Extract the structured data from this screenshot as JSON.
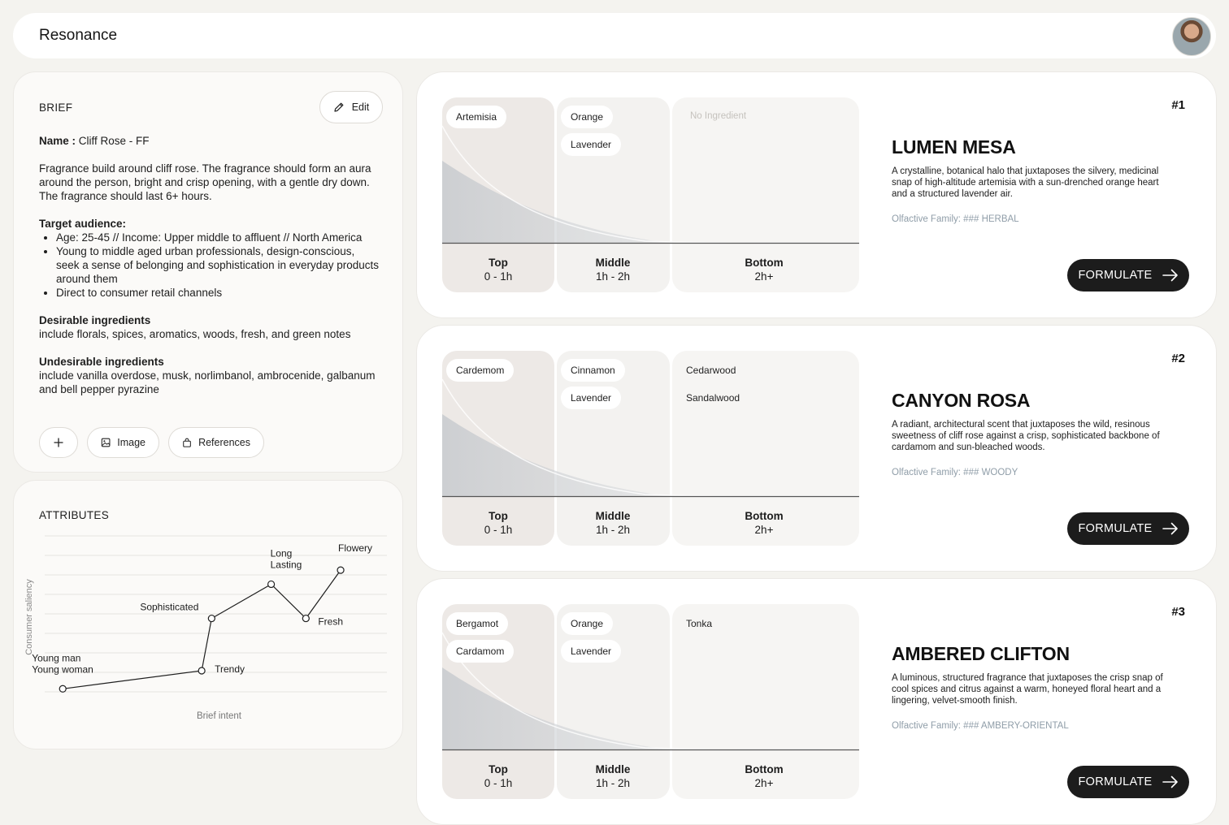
{
  "app": {
    "title": "Resonance"
  },
  "brief": {
    "title": "BRIEF",
    "edit_label": "Edit",
    "name_label": "Name :",
    "name_value": "Cliff Rose - FF",
    "description": "Fragrance build around cliff rose. The fragrance should form an aura around the person, bright and crisp opening, with a gentle dry down. The fragrance should last 6+ hours.",
    "target_heading": "Target audience:",
    "target_items": [
      "Age: 25-45 // Income: Upper middle to affluent // North America",
      "Young to middle aged urban professionals, design-conscious, seek a sense of belonging and sophistication in everyday products around them",
      "Direct to consumer retail channels"
    ],
    "desirable_heading": "Desirable ingredients",
    "desirable_text": "include florals, spices, aromatics, woods, fresh, and green notes",
    "undesirable_heading": "Undesirable ingredients",
    "undesirable_text": "include vanilla overdose, musk, norlimbanol, ambrocenide, galbanum and bell pepper pyrazine",
    "image_label": "Image",
    "references_label": "References"
  },
  "attributes": {
    "title": "ATTRIBUTES"
  },
  "chart_data": {
    "type": "line",
    "xlabel": "Brief intent",
    "ylabel": "Consumer saliency",
    "points": [
      {
        "label": "Young man\nYoung woman",
        "x": 0,
        "y": 0
      },
      {
        "label": "Trendy",
        "x": 2.8,
        "y": 0.9
      },
      {
        "label": "Sophisticated",
        "x": 3.0,
        "y": 3.5
      },
      {
        "label": "Long\nLasting",
        "x": 4.2,
        "y": 5.2
      },
      {
        "label": "Fresh",
        "x": 4.9,
        "y": 3.5
      },
      {
        "label": "Flowery",
        "x": 5.6,
        "y": 5.9
      }
    ],
    "xlim": [
      -0.2,
      6.5
    ],
    "ylim": [
      -0.15,
      7.6
    ],
    "grid": true,
    "colors": {
      "line": "#1f1f1f",
      "grid": "#e6e4e0",
      "label": "#1c1c1c"
    }
  },
  "tiers": [
    {
      "name": "Top",
      "time": "0 - 1h"
    },
    {
      "name": "Middle",
      "time": "1h - 2h"
    },
    {
      "name": "Bottom",
      "time": "2h+"
    }
  ],
  "no_ingredient_label": "No Ingredient",
  "formulate_label": "FORMULATE",
  "cards": [
    {
      "rank": "#1",
      "name": "LUMEN MESA",
      "description": "A crystalline, botanical halo that juxtaposes the silvery, medicinal snap of high-altitude artemisia with a sun-drenched orange heart and a structured lavender air.",
      "family": "Olfactive Family: ### HERBAL",
      "top": [
        "Artemisia"
      ],
      "middle": [
        "Orange",
        "Lavender"
      ],
      "bottom": []
    },
    {
      "rank": "#2",
      "name": "CANYON ROSA",
      "description": "A radiant, architectural scent that juxtaposes the wild, resinous sweetness of cliff rose against a crisp, sophisticated backbone of cardamom and sun-bleached woods.",
      "family": "Olfactive Family: ### WOODY",
      "top": [
        "Cardemom"
      ],
      "middle": [
        "Cinnamon",
        "Lavender"
      ],
      "bottom": [
        "Cedarwood",
        "Sandalwood"
      ]
    },
    {
      "rank": "#3",
      "name": "AMBERED CLIFTON",
      "description": "A luminous, structured fragrance that juxtaposes the crisp snap of cool spices and citrus against a warm, honeyed floral heart and a lingering, velvet-smooth finish.",
      "family": "Olfactive Family: ### AMBERY-ORIENTAL",
      "top": [
        "Bergamot",
        "Cardamom"
      ],
      "middle": [
        "Orange",
        "Lavender"
      ],
      "bottom": [
        "Tonka"
      ]
    }
  ]
}
